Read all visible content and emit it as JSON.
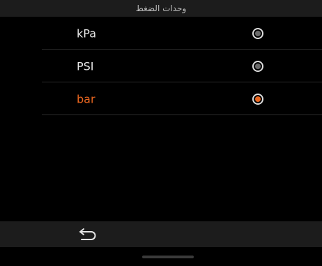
{
  "header": {
    "title": "وحدات الضغط"
  },
  "units": [
    {
      "label": "kPa",
      "selected": false
    },
    {
      "label": "PSI",
      "selected": false
    },
    {
      "label": "bar",
      "selected": true
    }
  ],
  "navigation": {
    "back_icon": "back-arrow-icon"
  },
  "colors": {
    "accent": "#e8651f",
    "background": "#000000",
    "bar": "#1c1c1c"
  }
}
